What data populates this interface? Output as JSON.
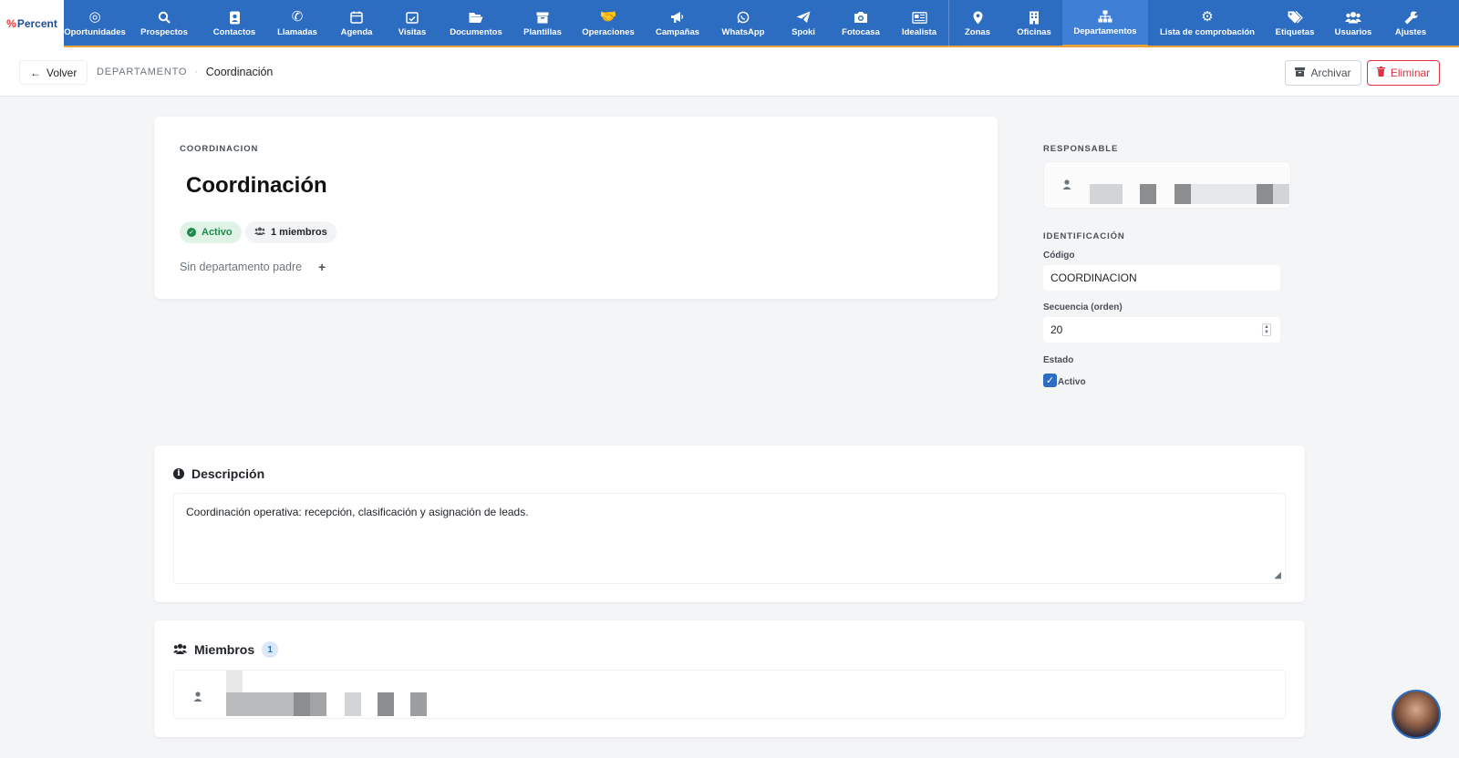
{
  "app": {
    "logo_text": "Percent",
    "logo_mark": "%"
  },
  "nav": {
    "items": [
      {
        "label": "Oportunidades",
        "icon": "target-icon"
      },
      {
        "label": "Prospectos",
        "icon": "search-icon"
      },
      {
        "label": "Contactos",
        "icon": "contact-book-icon"
      },
      {
        "label": "Llamadas",
        "icon": "phone-icon"
      },
      {
        "label": "Agenda",
        "icon": "calendar-icon"
      },
      {
        "label": "Visitas",
        "icon": "calendar-check-icon"
      },
      {
        "label": "Documentos",
        "icon": "folder-open-icon"
      },
      {
        "label": "Plantillas",
        "icon": "archive-icon"
      },
      {
        "label": "Operaciones",
        "icon": "handshake-icon"
      },
      {
        "label": "Campañas",
        "icon": "megaphone-icon"
      },
      {
        "label": "WhatsApp",
        "icon": "whatsapp-icon"
      },
      {
        "label": "Spoki",
        "icon": "paper-plane-icon"
      },
      {
        "label": "Fotocasa",
        "icon": "camera-icon"
      },
      {
        "label": "Idealista",
        "icon": "newspaper-icon"
      },
      {
        "label": "Zonas",
        "icon": "map-pin-icon"
      },
      {
        "label": "Oficinas",
        "icon": "building-icon"
      },
      {
        "label": "Departamentos",
        "icon": "sitemap-icon",
        "active": true
      },
      {
        "label": "Lista de comprobación",
        "icon": "gear-icon"
      },
      {
        "label": "Etiquetas",
        "icon": "tags-icon"
      },
      {
        "label": "Usuarios",
        "icon": "users-icon"
      },
      {
        "label": "Ajustes",
        "icon": "wrench-icon"
      }
    ]
  },
  "subbar": {
    "back_label": "Volver",
    "breadcrumb_section": "DEPARTAMENTO",
    "breadcrumb_current": "Coordinación",
    "archive_label": "Archivar",
    "delete_label": "Eliminar"
  },
  "department": {
    "code_label": "COORDINACION",
    "title": "Coordinación",
    "status_badge": "Activo",
    "members_badge": "1 miembros",
    "no_parent": "Sin departamento padre",
    "add_parent": "+"
  },
  "side": {
    "responsable_label": "RESPONSABLE",
    "identificacion_label": "IDENTIFICACIÓN",
    "codigo_label": "Código",
    "codigo_value": "COORDINACION",
    "secuencia_label": "Secuencia (orden)",
    "secuencia_value": "20",
    "estado_label": "Estado",
    "activo_label": "Activo",
    "activo_checked": true
  },
  "description": {
    "title": "Descripción",
    "text": "Coordinación operativa: recepción, clasificación y asignación de leads."
  },
  "members": {
    "title": "Miembros",
    "count": "1"
  },
  "colors": {
    "nav_bg": "#2c6cc1",
    "nav_active": "#3f80d6",
    "accent_orange": "#e8a23a",
    "success": "#1e8a4a",
    "danger": "#dc3545"
  }
}
